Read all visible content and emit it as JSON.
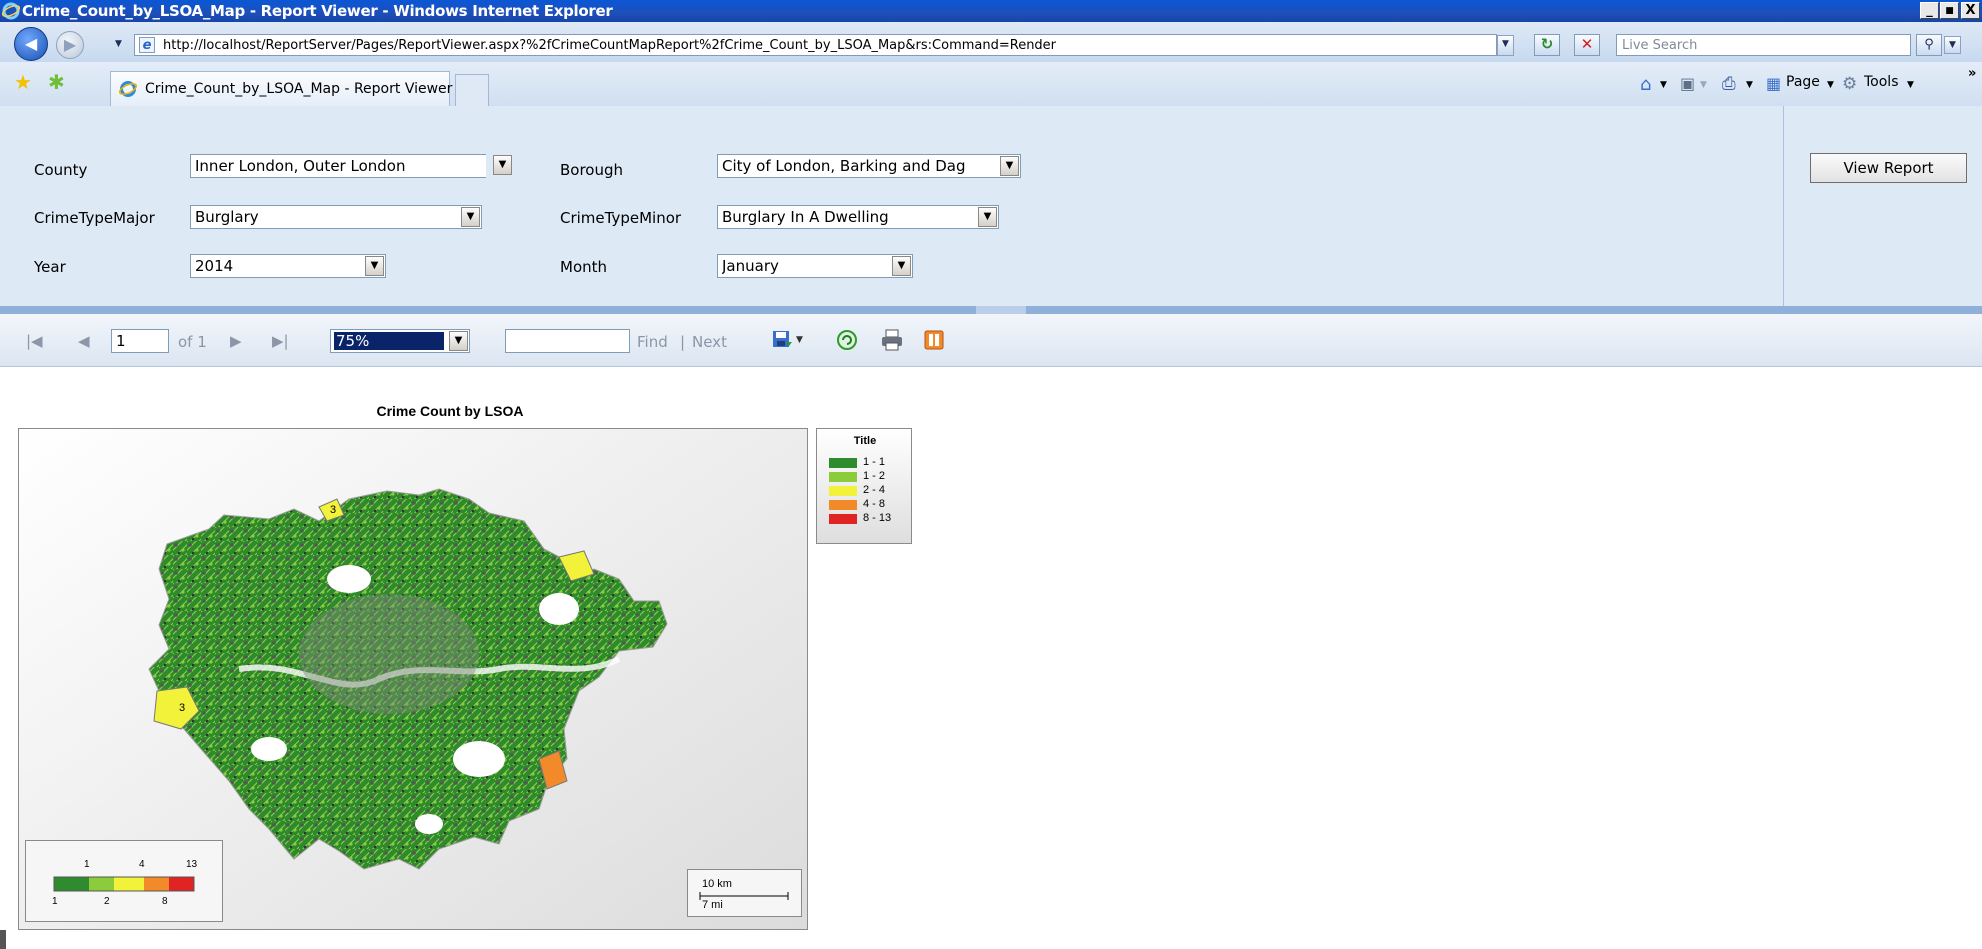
{
  "window": {
    "title": "Crime_Count_by_LSOA_Map - Report Viewer - Windows Internet Explorer",
    "minimize": "_",
    "maximize": "■",
    "close": "X"
  },
  "address_bar": {
    "url": "http://localhost/ReportServer/Pages/ReportViewer.aspx?%2fCrimeCountMapReport%2fCrime_Count_by_LSOA_Map&rs:Command=Render",
    "search_placeholder": "Live Search"
  },
  "tabs": [
    {
      "label": "Crime_Count_by_LSOA_Map - Report Viewer"
    }
  ],
  "command_bar": {
    "page_label": "Page",
    "tools_label": "Tools"
  },
  "parameters": {
    "county": {
      "label": "County",
      "value": "Inner London, Outer London"
    },
    "borough": {
      "label": "Borough",
      "value": "City of London, Barking and Dag"
    },
    "crime_type_major": {
      "label": "CrimeTypeMajor",
      "value": "Burglary"
    },
    "crime_type_minor": {
      "label": "CrimeTypeMinor",
      "value": "Burglary In A Dwelling"
    },
    "year": {
      "label": "Year",
      "value": "2014"
    },
    "month": {
      "label": "Month",
      "value": "January"
    },
    "view_report_label": "View Report"
  },
  "report_toolbar": {
    "current_page": "1",
    "of_pages": "of 1",
    "zoom": "75%",
    "find_label": "Find",
    "separator": "|",
    "next_label": "Next"
  },
  "report": {
    "map_title": "Crime Count by LSOA",
    "legend_title": "Title",
    "legend": [
      {
        "label": "1 - 1",
        "color": "#2e8b2e"
      },
      {
        "label": "1 - 2",
        "color": "#8ccc3c"
      },
      {
        "label": "2 - 4",
        "color": "#f2f23a"
      },
      {
        "label": "4 - 8",
        "color": "#f28a2a"
      },
      {
        "label": "8 - 13",
        "color": "#e02424"
      }
    ],
    "color_scale_top": [
      "1",
      "4",
      "13"
    ],
    "color_scale_bottom": [
      "1",
      "2",
      "8"
    ],
    "scale_km": "10 km",
    "scale_mi": "7 mi",
    "region_labels": [
      "3",
      "3"
    ]
  }
}
